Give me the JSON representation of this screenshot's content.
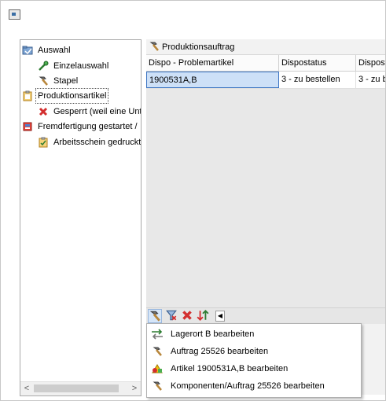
{
  "tree": {
    "items": [
      {
        "label": "Auswahl",
        "icon": "folder-selection-icon"
      },
      {
        "label": "Einzelauswahl",
        "icon": "wand-icon"
      },
      {
        "label": "Stapel",
        "icon": "hammer-icon"
      },
      {
        "label": "Produktionsartikel",
        "icon": "clipboard-icon"
      },
      {
        "label": "Gesperrt (weil eine Unte",
        "icon": "red-x-icon"
      },
      {
        "label": "Fremdfertigung gestartet /",
        "icon": "book-icon"
      },
      {
        "label": "Arbeitsschein gedruckt",
        "icon": "clipboard-icon"
      }
    ],
    "scroll_left": "<",
    "scroll_right": ">"
  },
  "panel": {
    "title": "Produktionsauftrag",
    "columns": [
      "Dispo - Problemartikel",
      "Dispostatus",
      "Dispost"
    ],
    "rows": [
      [
        "1900531A,B",
        "3 - zu bestellen",
        "3 - zu b"
      ]
    ]
  },
  "popup": {
    "items": [
      {
        "label": "Lagerort B bearbeiten",
        "icon": "arrows-green-icon"
      },
      {
        "label": "Auftrag 25526 bearbeiten",
        "icon": "hammer-icon"
      },
      {
        "label": "Artikel 1900531A,B bearbeiten",
        "icon": "colored-shapes-icon"
      },
      {
        "label": "Komponenten/Auftrag 25526 bearbeiten",
        "icon": "hammer-icon"
      }
    ]
  },
  "colors": {
    "selection_fill": "#cde0f7",
    "selection_border": "#3b73c2",
    "panel_bg": "#e8e8e8"
  }
}
